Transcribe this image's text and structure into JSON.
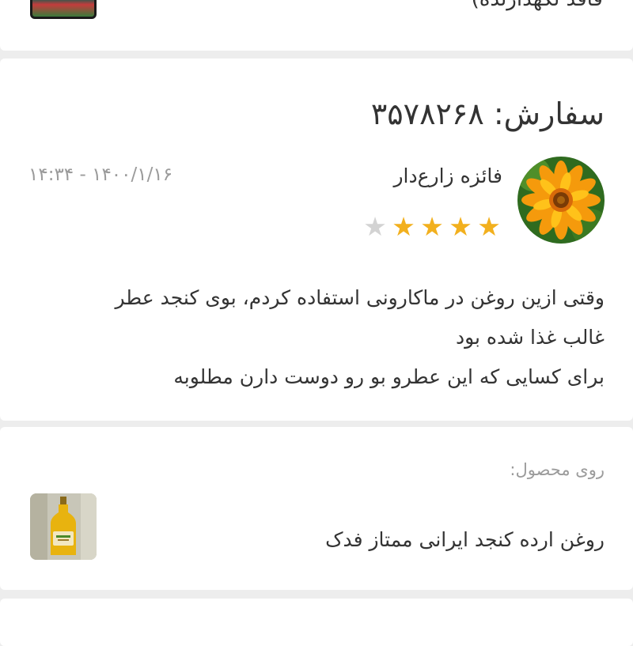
{
  "previous_review": {
    "partial_text": "فاقد نگهدارنده)"
  },
  "review": {
    "order_label": "سفارش: ۳۵۷۸۲۶۸",
    "datetime": "۱۴:۳۴ - ۱۴۰۰/۱/۱۶",
    "user_name": "فائزه زارع‌دار",
    "rating": 4,
    "rating_max": 5,
    "text_lines": [
      "وقتی ازین روغن در ماکارونی استفاده کردم، بوی کنجد عطر",
      "غالب غذا شده بود",
      "برای کسایی که این عطرو بو رو دوست دارن  مطلوبه"
    ]
  },
  "product": {
    "about_label": "روی محصول:",
    "name": "روغن ارده کنجد ایرانی ممتاز فدک"
  },
  "colors": {
    "star_active": "#f2b01e",
    "star_inactive": "#d3d3d3",
    "secondary_text": "#9b9b9b",
    "background": "#ededed"
  }
}
